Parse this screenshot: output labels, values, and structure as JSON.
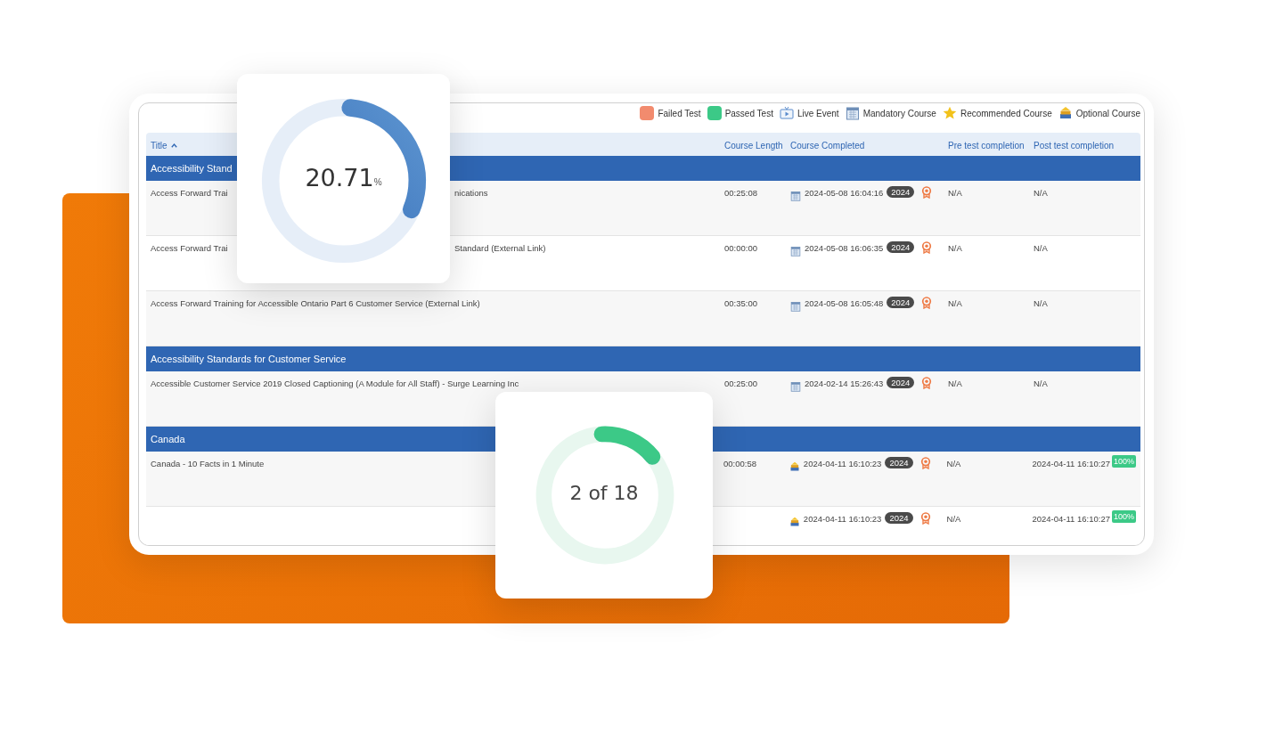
{
  "legend": [
    {
      "kind": "failed",
      "label": "Failed Test"
    },
    {
      "kind": "passed",
      "label": "Passed Test"
    },
    {
      "kind": "live",
      "label": "Live Event"
    },
    {
      "kind": "mandatory",
      "label": "Mandatory Course"
    },
    {
      "kind": "recommended",
      "label": "Recommended Course"
    },
    {
      "kind": "optional",
      "label": "Optional Course"
    }
  ],
  "table": {
    "columns": [
      {
        "label": "Title",
        "sorted": true
      },
      {
        "label": "Course Length",
        "sorted": false
      },
      {
        "label": "Course Completed",
        "sorted": false
      },
      {
        "label": "Pre test completion",
        "sorted": false
      },
      {
        "label": "Post test completion",
        "sorted": false
      }
    ],
    "groups": [
      {
        "title": "Accessibility Stand",
        "rows": [
          {
            "title_parts": [
              "Access Forward Trai",
              "nications"
            ],
            "length": "00:25:08",
            "kind": "mandatory",
            "completed": "2024-05-08 16:04:16",
            "year": "2024",
            "pre": "N/A",
            "post": "N/A"
          },
          {
            "title_parts": [
              "Access Forward Trai",
              "Standard (External Link)"
            ],
            "length": "00:00:00",
            "kind": "mandatory",
            "completed": "2024-05-08 16:06:35",
            "year": "2024",
            "pre": "N/A",
            "post": "N/A"
          },
          {
            "title_parts": [
              "Access Forward Training for Accessible Ontario Part 6 Customer Service (External Link)"
            ],
            "length": "00:35:00",
            "kind": "mandatory",
            "completed": "2024-05-08 16:05:48",
            "year": "2024",
            "pre": "N/A",
            "post": "N/A"
          }
        ]
      },
      {
        "title": "Accessibility Standards for Customer Service",
        "rows": [
          {
            "title_parts": [
              "Accessible Customer Service 2019 Closed Captioning (A Module for All Staff) - Surge Learning Inc"
            ],
            "length": "00:25:00",
            "kind": "mandatory",
            "completed": "2024-02-14 15:26:43",
            "year": "2024",
            "pre": "N/A",
            "post": "N/A"
          }
        ]
      },
      {
        "title": "Canada",
        "rows": [
          {
            "title_parts": [
              "Canada - 10 Facts in 1 Minute"
            ],
            "length": "00:00:58",
            "kind": "optional",
            "completed": "2024-04-11 16:10:23",
            "year": "2024",
            "pre": "N/A",
            "post": "2024-04-11 16:10:27",
            "post_score": "100%"
          },
          {
            "title_parts": [],
            "kind": "optional",
            "completed": "2024-04-11 16:10:23",
            "year": "2024",
            "pre": "N/A",
            "post": "2024-04-11 16:10:27",
            "post_score": "100%"
          }
        ]
      }
    ]
  },
  "progress_card": {
    "value": "20.71",
    "unit": "%",
    "level": 0.3
  },
  "count_card": {
    "value": "2 of 18",
    "level": 0.15
  }
}
